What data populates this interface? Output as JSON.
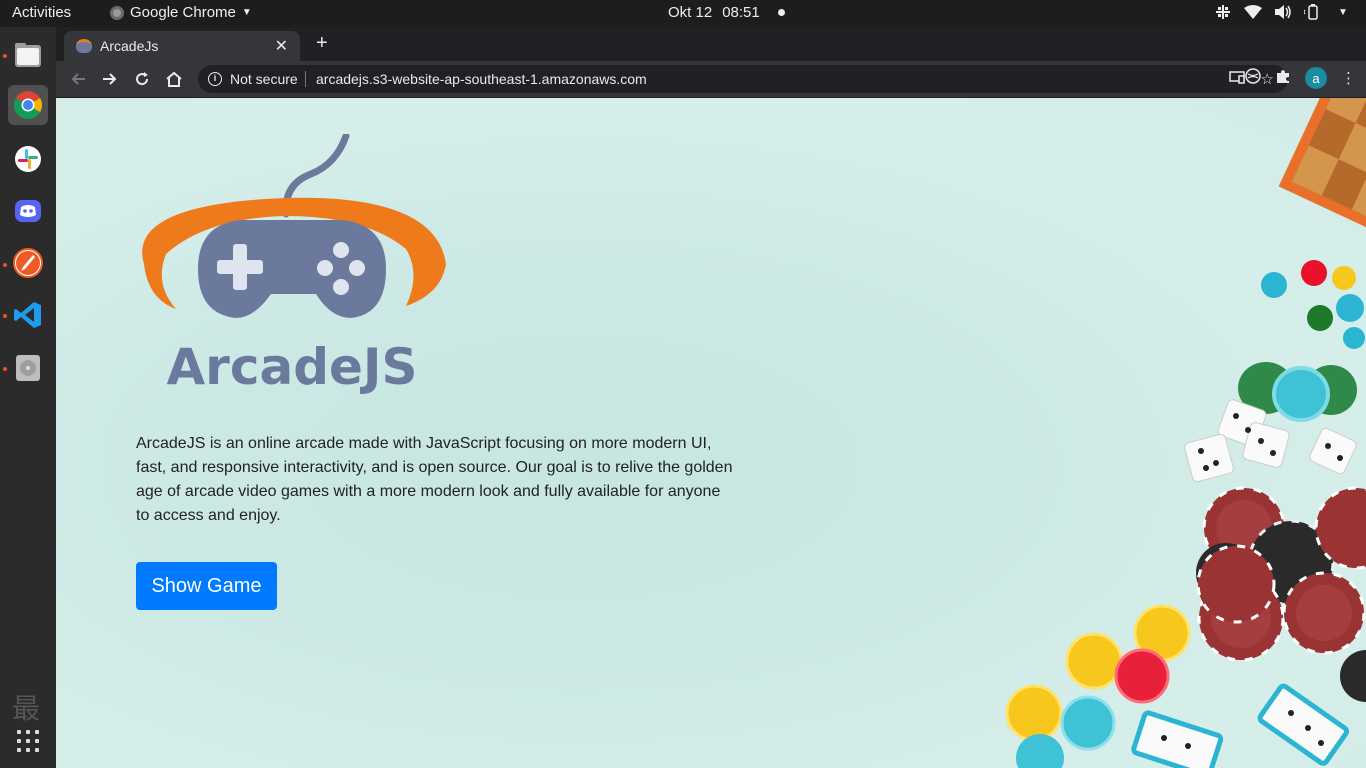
{
  "topbar": {
    "activities": "Activities",
    "app_name": "Google Chrome",
    "date": "Okt 12",
    "time": "08:51"
  },
  "dock": {
    "items": [
      "files-icon",
      "chrome-icon",
      "slack-icon",
      "discord-icon",
      "postman-icon",
      "vscode-icon",
      "disk-icon"
    ],
    "ghost_text": "最"
  },
  "browser": {
    "tab_title": "ArcadeJs",
    "security_label": "Not secure",
    "url": "arcadejs.s3-website-ap-southeast-1.amazonaws.com",
    "avatar_letter": "a"
  },
  "page": {
    "logo_text": "ArcadeJS",
    "description": "ArcadeJS is an online arcade made with JavaScript focusing on more modern UI, fast, and responsive interactivity, and is open source. Our goal is to relive the golden age of arcade video games with a more modern look and fully available for anyone to access and enjoy.",
    "button_label": "Show Game"
  },
  "colors": {
    "accent": "#007bff",
    "logo_orange": "#ee7a1c",
    "logo_blue": "#6b7a9c",
    "page_bg": "#cfeae6"
  }
}
